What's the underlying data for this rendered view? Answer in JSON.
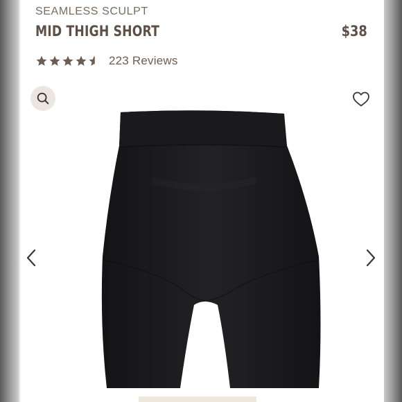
{
  "product": {
    "collection": "SEAMLESS SCULPT",
    "name": "MID THIGH SHORT",
    "price": "$38"
  },
  "rating": {
    "value": 4.5,
    "max": 5,
    "reviews_label": "223 Reviews"
  },
  "icons": {
    "search": "search-icon",
    "wishlist": "heart-outline-icon",
    "prev": "chevron-left-icon",
    "next": "chevron-right-icon",
    "star": "star-icon"
  },
  "colors": {
    "text_brown": "#5e5046",
    "star": "#6b5d52",
    "search_bg": "#ebe6e0",
    "product": "#1c1c1e"
  }
}
